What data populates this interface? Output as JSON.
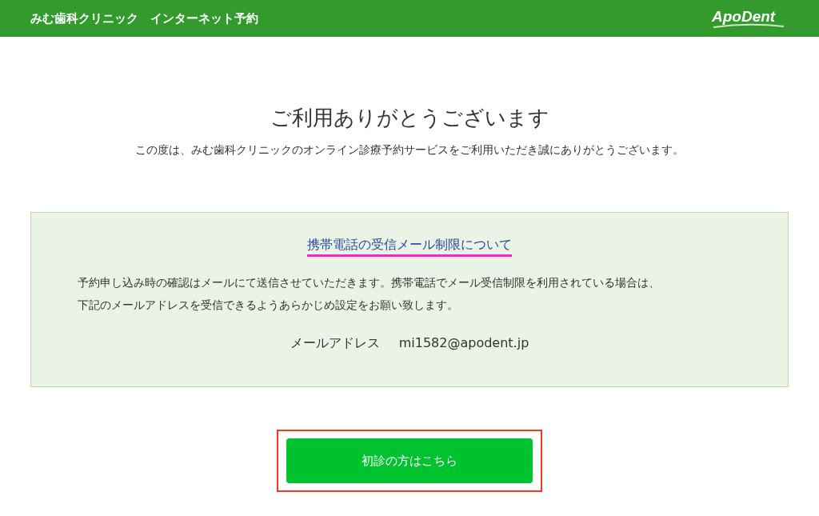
{
  "header": {
    "title": "みむ歯科クリニック　インターネット予約",
    "logo": "ApoDent"
  },
  "heading": "ご利用ありがとうございます",
  "intro": "この度は、みむ歯科クリニックのオンライン診療予約サービスをご利用いただき誠にありがとうございます。",
  "notice": {
    "title": "携帯電話の受信メール制限について",
    "lines": [
      "予約申し込み時の確認はメールにて送信させていただきます。携帯電話でメール受信制限を利用されている場合は、",
      "下記のメールアドレスを受信できるようあらかじめ設定をお願い致します。"
    ],
    "email_label": "メールアドレス",
    "email": "mi1582@apodent.jp"
  },
  "button": {
    "label": "初診の方はこちら"
  }
}
